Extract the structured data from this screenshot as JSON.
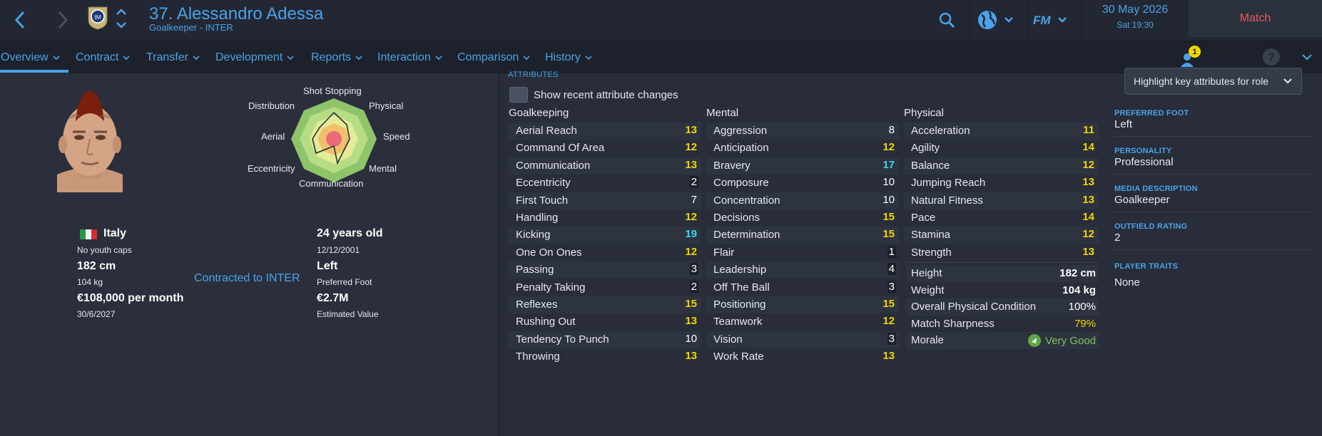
{
  "header": {
    "player_title": "37. Alessandro Adessa",
    "player_subtitle": "Goalkeeper - INTER",
    "date": "30 May 2026",
    "time": "Sat 19:30",
    "match_button": "Match",
    "notification_count": "1"
  },
  "tabs": [
    {
      "label": "Overview",
      "active": true
    },
    {
      "label": "Contract"
    },
    {
      "label": "Transfer"
    },
    {
      "label": "Development"
    },
    {
      "label": "Reports"
    },
    {
      "label": "Interaction"
    },
    {
      "label": "Comparison"
    },
    {
      "label": "History"
    }
  ],
  "profile": {
    "nationality": "Italy",
    "youth_caps": "No youth caps",
    "height": "182 cm",
    "weight": "104 kg",
    "wage": "€108,000 per month",
    "contract_end": "30/6/2027",
    "age": "24 years old",
    "dob": "12/12/2001",
    "foot": "Left",
    "foot_label": "Preferred Foot",
    "value": "€2.7M",
    "value_label": "Estimated Value",
    "contracted": "Contracted to INTER"
  },
  "radar": {
    "labels": [
      "Shot Stopping",
      "Physical",
      "Speed",
      "Mental",
      "Communication",
      "Eccentricity",
      "Aerial",
      "Distribution"
    ]
  },
  "attributes": {
    "section_label": "ATTRIBUTES",
    "show_changes_label": "Show recent attribute changes",
    "highlight_dropdown": "Highlight key attributes for role",
    "goalkeeping": {
      "title": "Goalkeeping",
      "rows": [
        {
          "name": "Aerial Reach",
          "value": "13",
          "tone": "yellow"
        },
        {
          "name": "Command Of Area",
          "value": "12",
          "tone": "yellow"
        },
        {
          "name": "Communication",
          "value": "13",
          "tone": "yellow"
        },
        {
          "name": "Eccentricity",
          "value": "2",
          "tone": "dark"
        },
        {
          "name": "First Touch",
          "value": "7",
          "tone": "white"
        },
        {
          "name": "Handling",
          "value": "12",
          "tone": "yellow"
        },
        {
          "name": "Kicking",
          "value": "19",
          "tone": "cyan"
        },
        {
          "name": "One On Ones",
          "value": "12",
          "tone": "yellow"
        },
        {
          "name": "Passing",
          "value": "3",
          "tone": "dark"
        },
        {
          "name": "Penalty Taking",
          "value": "2",
          "tone": "dark"
        },
        {
          "name": "Reflexes",
          "value": "15",
          "tone": "yellow"
        },
        {
          "name": "Rushing Out",
          "value": "13",
          "tone": "yellow"
        },
        {
          "name": "Tendency To Punch",
          "value": "10",
          "tone": "white"
        },
        {
          "name": "Throwing",
          "value": "13",
          "tone": "yellow"
        }
      ]
    },
    "mental": {
      "title": "Mental",
      "rows": [
        {
          "name": "Aggression",
          "value": "8",
          "tone": "white"
        },
        {
          "name": "Anticipation",
          "value": "12",
          "tone": "yellow"
        },
        {
          "name": "Bravery",
          "value": "17",
          "tone": "cyan"
        },
        {
          "name": "Composure",
          "value": "10",
          "tone": "white"
        },
        {
          "name": "Concentration",
          "value": "10",
          "tone": "white"
        },
        {
          "name": "Decisions",
          "value": "15",
          "tone": "yellow"
        },
        {
          "name": "Determination",
          "value": "15",
          "tone": "yellow"
        },
        {
          "name": "Flair",
          "value": "1",
          "tone": "dark"
        },
        {
          "name": "Leadership",
          "value": "4",
          "tone": "dark"
        },
        {
          "name": "Off The Ball",
          "value": "3",
          "tone": "dark"
        },
        {
          "name": "Positioning",
          "value": "15",
          "tone": "yellow"
        },
        {
          "name": "Teamwork",
          "value": "12",
          "tone": "yellow"
        },
        {
          "name": "Vision",
          "value": "3",
          "tone": "dark"
        },
        {
          "name": "Work Rate",
          "value": "13",
          "tone": "yellow"
        }
      ]
    },
    "physical": {
      "title": "Physical",
      "rows": [
        {
          "name": "Acceleration",
          "value": "11",
          "tone": "yellow"
        },
        {
          "name": "Agility",
          "value": "14",
          "tone": "yellow"
        },
        {
          "name": "Balance",
          "value": "12",
          "tone": "yellow"
        },
        {
          "name": "Jumping Reach",
          "value": "13",
          "tone": "yellow"
        },
        {
          "name": "Natural Fitness",
          "value": "13",
          "tone": "yellow"
        },
        {
          "name": "Pace",
          "value": "14",
          "tone": "yellow"
        },
        {
          "name": "Stamina",
          "value": "12",
          "tone": "yellow"
        },
        {
          "name": "Strength",
          "value": "13",
          "tone": "yellow"
        }
      ]
    },
    "physical_stats": [
      {
        "name": "Height",
        "value": "182 cm"
      },
      {
        "name": "Weight",
        "value": "104 kg"
      },
      {
        "name": "Overall Physical Condition",
        "value": "100%"
      },
      {
        "name": "Match Sharpness",
        "value": "79%"
      },
      {
        "name": "Morale",
        "value": "Very Good"
      }
    ]
  },
  "info": {
    "preferred_foot_label": "PREFERRED FOOT",
    "preferred_foot": "Left",
    "personality_label": "PERSONALITY",
    "personality": "Professional",
    "media_label": "MEDIA DESCRIPTION",
    "media": "Goalkeeper",
    "outfield_label": "OUTFIELD RATING",
    "outfield": "2",
    "traits_label": "PLAYER TRAITS",
    "traits": "None"
  },
  "colors": {
    "accent": "#4aa3e8",
    "match": "#e8595e",
    "yellow": "#f2d600",
    "cyan": "#38d9ea",
    "good": "#7cc45a"
  }
}
